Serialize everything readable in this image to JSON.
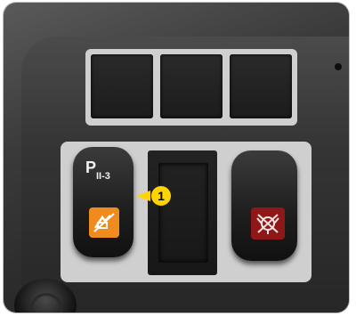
{
  "callout": {
    "number": "1"
  },
  "left_switch": {
    "top_symbol": "P",
    "top_symbol_sub": "II-3",
    "lamp_color": "#f08c1e"
  },
  "right_switch": {
    "lamp_color": "#8e1818"
  }
}
